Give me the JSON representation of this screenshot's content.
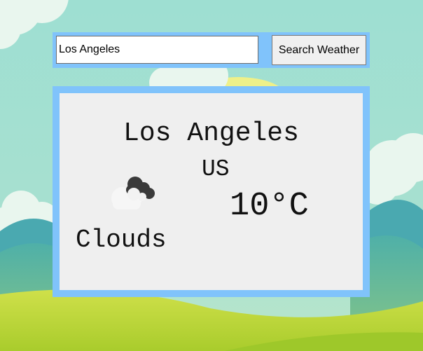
{
  "search": {
    "value": "Los Angeles",
    "button_label": "Search Weather"
  },
  "weather": {
    "city": "Los Angeles",
    "country": "US",
    "temperature": "10°C",
    "condition": "Clouds",
    "icon": "clouds-icon"
  },
  "colors": {
    "panel_border": "#80c3fb",
    "panel_bg": "#efefef",
    "sky": "#9cdcd0",
    "hills": "#5fb79d",
    "grass": "#c8d93c"
  }
}
